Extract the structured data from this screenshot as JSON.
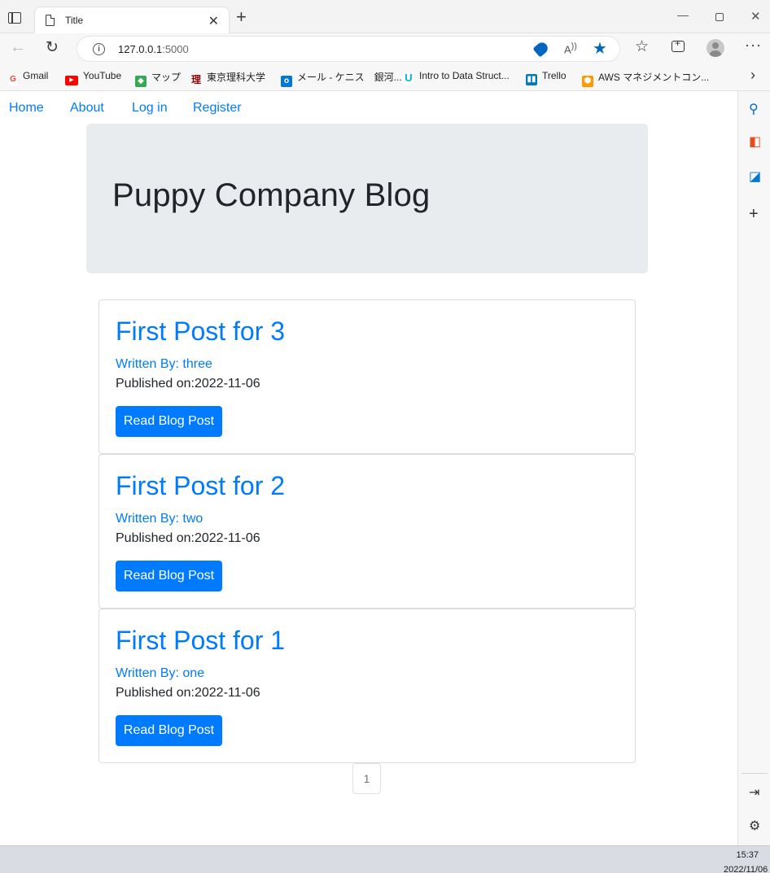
{
  "browser": {
    "tab_title": "Title",
    "url_host": "127.0.0.1",
    "url_port": ":5000",
    "bookmarks": [
      {
        "label": "Gmail",
        "icon": "gmail-icon",
        "color": "#ea4335"
      },
      {
        "label": "YouTube",
        "icon": "youtube-icon",
        "color": "#ff0000"
      },
      {
        "label": "マップ",
        "icon": "maps-icon",
        "color": "#34a853"
      },
      {
        "label": "東京理科大学",
        "icon": "university-icon",
        "color": "#8b0000"
      },
      {
        "label": "メール - ケニス　銀河...",
        "icon": "outlook-icon",
        "color": "#0078d4"
      },
      {
        "label": "Intro to Data Struct...",
        "icon": "udacity-icon",
        "color": "#02b3e4"
      },
      {
        "label": "Trello",
        "icon": "trello-icon",
        "color": "#0079bf"
      },
      {
        "label": "AWS マネジメントコン...",
        "icon": "aws-icon",
        "color": "#ff9900"
      }
    ]
  },
  "nav": {
    "home": "Home",
    "about": "About",
    "login": "Log in",
    "register": "Register"
  },
  "jumbotron": {
    "title": "Puppy Company Blog"
  },
  "posts": [
    {
      "title": "First Post for 3",
      "author": "Written By: three",
      "published_label": "Published on:",
      "date": "2022-11-06",
      "button": "Read Blog Post"
    },
    {
      "title": "First Post for 2",
      "author": "Written By: two",
      "published_label": "Published on:",
      "date": "2022-11-06",
      "button": "Read Blog Post"
    },
    {
      "title": "First Post for 1",
      "author": "Written By: one",
      "published_label": "Published on:",
      "date": "2022-11-06",
      "button": "Read Blog Post"
    }
  ],
  "pagination": {
    "current": "1"
  },
  "taskbar": {
    "time": "15:37",
    "date": "2022/11/06"
  },
  "colors": {
    "link": "#007bff",
    "button": "#007bff",
    "jumbotron_bg": "#e9ecef",
    "browser_accent": "#0067c0"
  }
}
